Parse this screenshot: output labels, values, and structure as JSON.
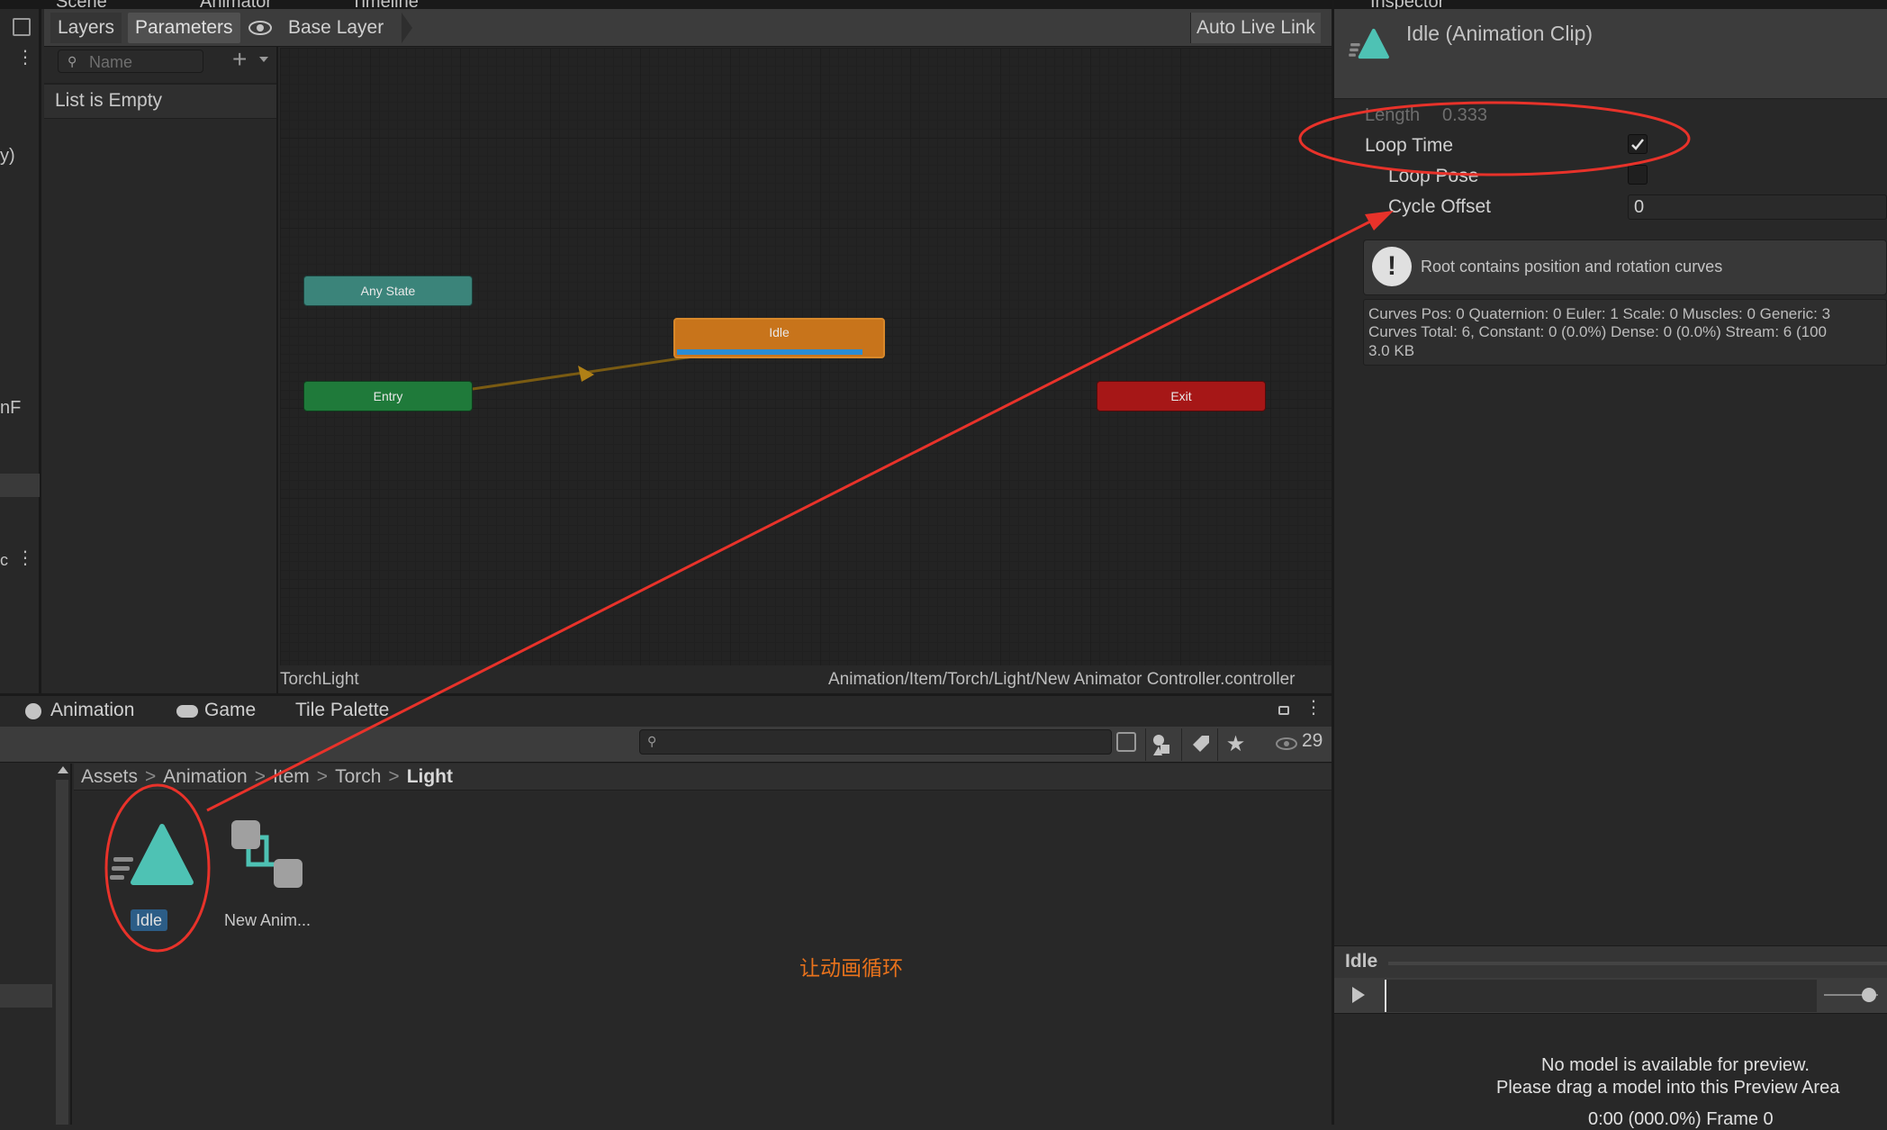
{
  "top_tabs": {
    "scene": "Scene",
    "animator": "Animator",
    "timeline": "Timeline"
  },
  "animator": {
    "tab_layers": "Layers",
    "tab_parameters": "Parameters",
    "breadcrumb": "Base Layer",
    "auto_live_link": "Auto Live Link",
    "search_placeholder": "Name",
    "list_empty": "List is Empty",
    "states": {
      "any_state": "Any State",
      "entry": "Entry",
      "idle": "Idle",
      "exit": "Exit"
    },
    "footer_left": "TorchLight",
    "footer_right": "Animation/Item/Torch/Light/New Animator Controller.controller"
  },
  "left_strip": {
    "fragment_1": "y)",
    "fragment_2": "nF",
    "fragment_3": "c"
  },
  "bottom_tabs": {
    "animation": "Animation",
    "game": "Game",
    "tile_palette": "Tile Palette"
  },
  "project": {
    "search_value": "",
    "hidden_count": "29",
    "breadcrumb": [
      "Assets",
      "Animation",
      "Item",
      "Torch",
      "Light"
    ],
    "assets": [
      {
        "label": "Idle"
      },
      {
        "label": "New Anim..."
      }
    ]
  },
  "annotation": {
    "text": "让动画循环",
    "color": "#e8721c"
  },
  "inspector": {
    "tab": "Inspector",
    "title": "Idle (Animation Clip)",
    "length_label": "Length",
    "length_value": "0.333",
    "loop_time_label": "Loop Time",
    "loop_time_checked": true,
    "loop_pose_label": "Loop Pose",
    "loop_pose_checked": false,
    "cycle_offset_label": "Cycle Offset",
    "cycle_offset_value": "0",
    "warning": "Root contains position and rotation curves",
    "curves_line1": "Curves Pos: 0 Quaternion: 0 Euler: 1 Scale: 0 Muscles: 0 Generic: 3",
    "curves_line2": "Curves Total: 6, Constant: 0 (0.0%) Dense: 0 (0.0%) Stream: 6 (100",
    "curves_line3": "3.0 KB",
    "preview_name": "Idle",
    "preview_msg1": "No model is available for preview.",
    "preview_msg2": "Please drag a model into this Preview Area",
    "preview_time": "0:00 (000.0%) Frame 0"
  },
  "colors": {
    "accent_teal": "#4ec2b4",
    "annotation_red": "#e8322a",
    "idle_orange": "#c8741b",
    "exit_red": "#a61717",
    "entry_green": "#1f7a3a",
    "any_state_teal": "#3b847a"
  }
}
